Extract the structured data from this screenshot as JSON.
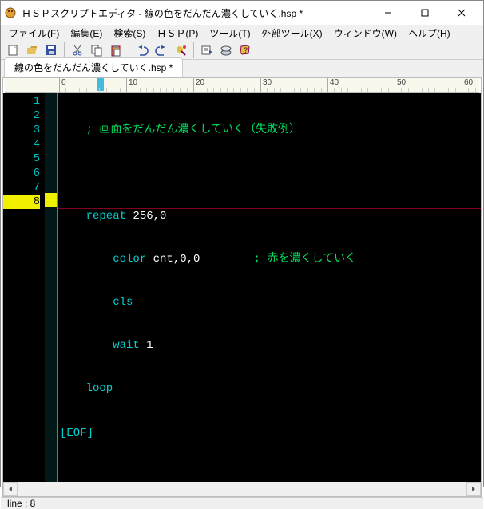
{
  "title": "ＨＳＰスクリプトエディタ - 線の色をだんだん濃くしていく.hsp *",
  "menu": {
    "file": "ファイル(F)",
    "edit": "編集(E)",
    "search": "検索(S)",
    "hsp": "ＨＳＰ(P)",
    "tool": "ツール(T)",
    "exttool": "外部ツール(X)",
    "window": "ウィンドウ(W)",
    "help": "ヘルプ(H)"
  },
  "tab": {
    "label": "線の色をだんだん濃くしていく.hsp *"
  },
  "ruler": {
    "marks": [
      "0",
      "10",
      "20",
      "30",
      "40",
      "50",
      "60"
    ]
  },
  "code": {
    "lines": [
      "1",
      "2",
      "3",
      "4",
      "5",
      "6",
      "7",
      "8"
    ],
    "l1_comment": "    ; 画面をだんだん濃くしていく（失敗例）",
    "l3_kw": "    repeat",
    "l3_args": " 256,0",
    "l4_cmd": "        color",
    "l4_args": " cnt,0,0",
    "l4_pad": "        ",
    "l4_comment": "; 赤を濃くしていく",
    "l5_cmd": "        cls",
    "l6_cmd": "        wait",
    "l6_args": " 1",
    "l7_kw": "    loop",
    "l8_eof": "[EOF]",
    "current_line": 8
  },
  "status": {
    "text": "line : 8"
  }
}
